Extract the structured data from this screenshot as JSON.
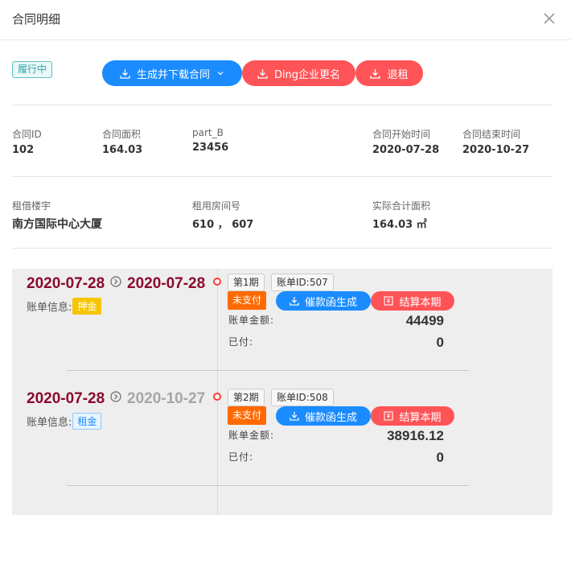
{
  "dialog": {
    "title": "合同明细"
  },
  "status": "履行中",
  "actions": {
    "generate": "生成并下载合同",
    "ding_rename": "Ding企业更名",
    "terminate": "退租"
  },
  "info": {
    "contract_id_label": "合同ID",
    "contract_id": "102",
    "area_label": "合同面积",
    "area": "164.03",
    "partb_label": "part_B",
    "partb": "23456",
    "start_label": "合同开始时间",
    "start": "2020-07-28",
    "end_label": "合同结束时间",
    "end": "2020-10-27",
    "building_label": "租借楼宇",
    "building": "南方国际中心大厦",
    "room_label": "租用房间号",
    "room": "610 ， 607",
    "actual_area_label": "实际合计面积",
    "actual_area": "164.03 ㎡"
  },
  "bills": [
    {
      "date_from": "2020-07-28",
      "date_to": "2020-07-28",
      "info_label": "账单信息:",
      "type": "押金",
      "period": "第1期",
      "bill_id": "账单ID:507",
      "status": "未支付",
      "notice_btn": "催款函生成",
      "settle_btn": "结算本期",
      "amount_label": "账单金额:",
      "amount": "44499",
      "paid_label": "已付:",
      "paid": "0"
    },
    {
      "date_from": "2020-07-28",
      "date_to": "2020-10-27",
      "info_label": "账单信息:",
      "type": "租金",
      "period": "第2期",
      "bill_id": "账单ID:508",
      "status": "未支付",
      "notice_btn": "催款函生成",
      "settle_btn": "结算本期",
      "amount_label": "账单金额:",
      "amount": "38916.12",
      "paid_label": "已付:",
      "paid": "0"
    }
  ],
  "colors": {
    "primary": "#1a8cff",
    "danger": "#ff5457",
    "date": "#8b0a2e",
    "unpaid": "#ff6a00"
  }
}
